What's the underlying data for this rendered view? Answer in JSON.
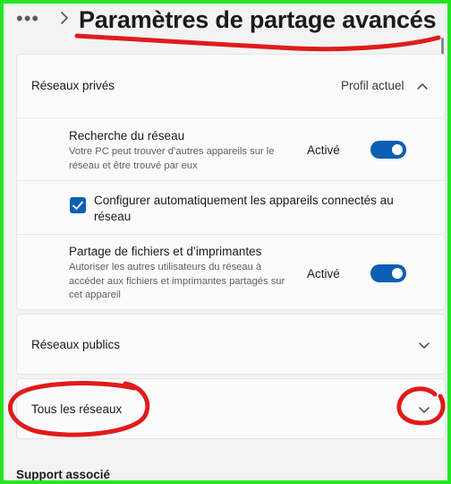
{
  "header": {
    "more_label": "•••",
    "title": "Paramètres de partage avancés"
  },
  "private_networks": {
    "label": "Réseaux privés",
    "profile_label": "Profil actuel",
    "network_discovery": {
      "title": "Recherche du réseau",
      "description": "Votre PC peut trouver d’autres appareils sur le réseau et être trouvé par eux",
      "status": "Activé",
      "enabled": true
    },
    "auto_configure": {
      "label": "Configurer automatiquement les appareils connectés au réseau",
      "checked": true
    },
    "file_printer_sharing": {
      "title": "Partage de fichiers et d’imprimantes",
      "description": "Autoriser les autres utilisateurs du réseau à accéder aux fichiers et imprimantes partagés sur cet appareil",
      "status": "Activé",
      "enabled": true
    }
  },
  "public_networks": {
    "label": "Réseaux publics"
  },
  "all_networks": {
    "label": "Tous les réseaux"
  },
  "related_support": {
    "label": "Support associé"
  },
  "colors": {
    "accent": "#0a5fb4",
    "annotation": "#e01b1b",
    "border": "#22e622"
  },
  "icons": {
    "breadcrumb": "chevron-right-icon",
    "expand": "chevron-down-icon",
    "collapse": "chevron-up-icon",
    "check": "checkmark-icon"
  }
}
